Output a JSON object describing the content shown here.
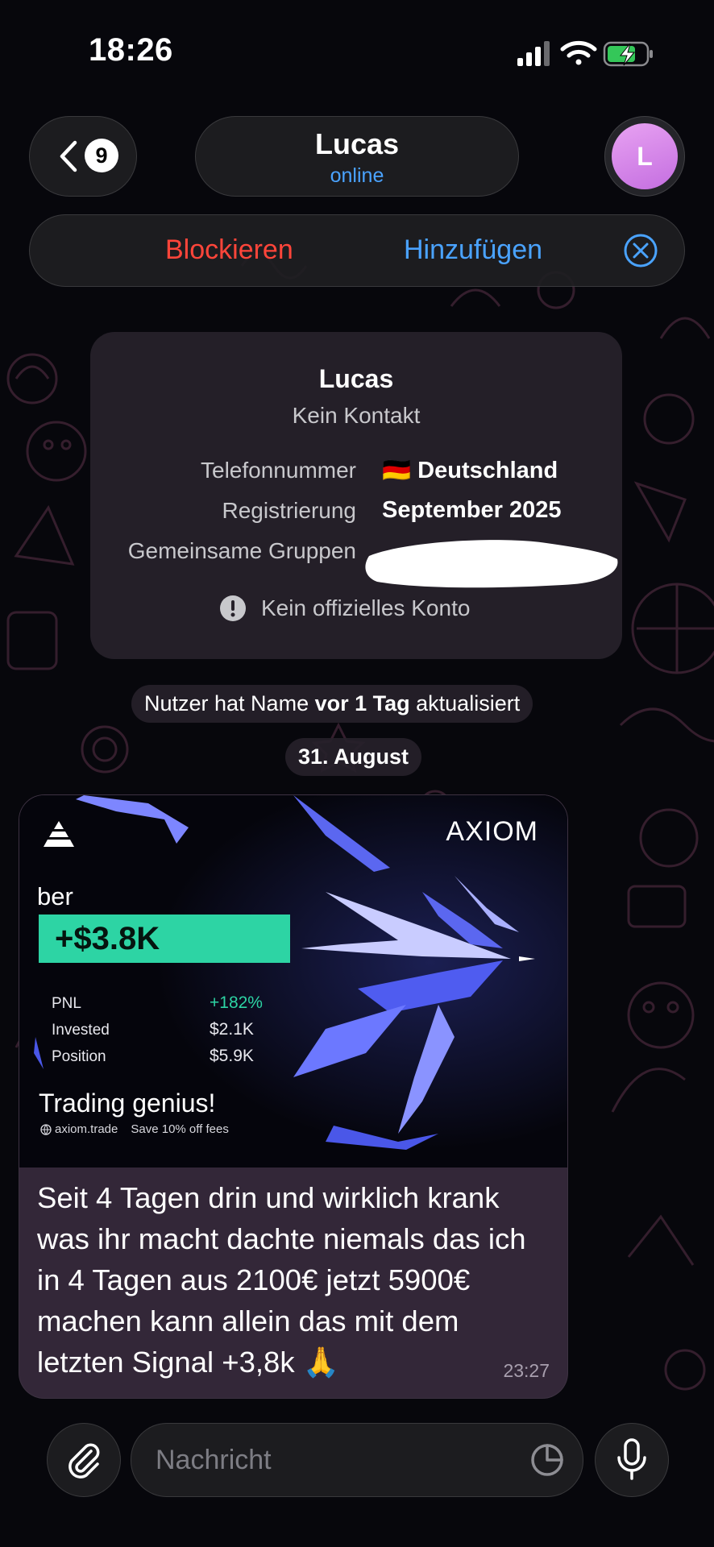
{
  "status_bar": {
    "time": "18:26",
    "battery_state": "charging"
  },
  "header": {
    "unread_count": "9",
    "contact_name": "Lucas",
    "contact_status": "online",
    "avatar_initial": "L",
    "avatar_color": "#d57ee8"
  },
  "action_bar": {
    "block_label": "Blockieren",
    "add_label": "Hinzufügen"
  },
  "info_card": {
    "name": "Lucas",
    "subtitle": "Kein Kontakt",
    "rows": [
      {
        "label": "Telefonnummer",
        "flag": "🇩🇪",
        "value": "Deutschland"
      },
      {
        "label": "Registrierung",
        "value": "September 2025"
      },
      {
        "label": "Gemeinsame Gruppen",
        "value": ""
      }
    ],
    "notice": "Kein offizielles Konto"
  },
  "service_message": {
    "prefix": "Nutzer hat Name ",
    "bold": "vor 1 Tag",
    "suffix": " aktualisiert"
  },
  "date_separator": "31. August",
  "message": {
    "image": {
      "brand": "AXIOM",
      "ticker": "ber",
      "pnl_amount": "+$3.8K",
      "stats": [
        {
          "label": "PNL",
          "value": "+182%"
        },
        {
          "label": "Invested",
          "value": "$2.1K"
        },
        {
          "label": "Position",
          "value": "$5.9K"
        }
      ],
      "tagline": "Trading genius!",
      "site": "axiom.trade",
      "promo": "Save 10% off fees"
    },
    "text": "Seit 4 Tagen drin und wirklich krank was ihr macht dachte niemals das ich in 4 Tagen aus 2100€ jetzt 5900€ machen kann allein das mit dem letzten Signal +3,8k 🙏",
    "time": "23:27"
  },
  "composer": {
    "placeholder": "Nachricht"
  },
  "colors": {
    "accent_blue": "#4aa3ff",
    "danger_red": "#ff453a",
    "pnl_green": "#2dd4a4",
    "battery_green": "#34c759"
  }
}
